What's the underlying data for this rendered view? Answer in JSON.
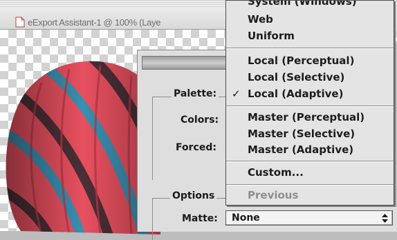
{
  "document": {
    "title": "eExport Assistant-1 @ 100% (Laye"
  },
  "dialog": {
    "palette_label": "Palette:",
    "colors_label": "Colors:",
    "forced_label": "Forced:",
    "options_label": "Options",
    "matte_label": "Matte:",
    "matte_value": "None"
  },
  "palette_menu": {
    "items": [
      {
        "label": "System (Windows)",
        "enabled": true,
        "checked": false
      },
      {
        "label": "Web",
        "enabled": true,
        "checked": false
      },
      {
        "label": "Uniform",
        "enabled": true,
        "checked": false
      },
      {
        "label": "Local (Perceptual)",
        "enabled": true,
        "checked": false
      },
      {
        "label": "Local (Selective)",
        "enabled": true,
        "checked": false
      },
      {
        "label": "Local (Adaptive)",
        "enabled": true,
        "checked": true
      },
      {
        "label": "Master (Perceptual)",
        "enabled": true,
        "checked": false
      },
      {
        "label": "Master (Selective)",
        "enabled": true,
        "checked": false
      },
      {
        "label": "Master (Adaptive)",
        "enabled": true,
        "checked": false
      },
      {
        "label": "Custom...",
        "enabled": true,
        "checked": false
      },
      {
        "label": "Previous",
        "enabled": false,
        "checked": false
      }
    ],
    "check_glyph": "✓"
  },
  "colors": {
    "balloon_red": "#e8505f",
    "balloon_teal": "#3b8fb0",
    "balloon_dark": "#4a2f36",
    "menu_bg": "#e4e4e4",
    "dialog_bg": "#dedede"
  }
}
